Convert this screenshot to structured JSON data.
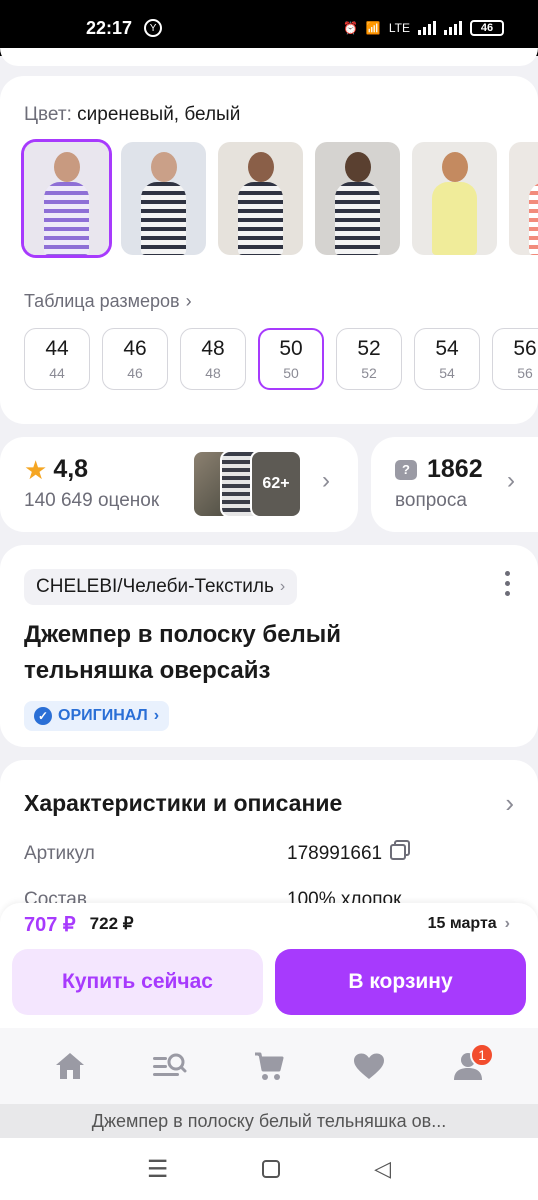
{
  "status_bar": {
    "time": "22:17",
    "network": "LTE",
    "battery": "46"
  },
  "color_section": {
    "label": "Цвет:",
    "value": "сиреневый, белый",
    "swatches": [
      "lilac-stripes",
      "navy-stripes",
      "black-stripes-grey",
      "black-stripes-black-hem",
      "yellow-knit",
      "coral-stripes"
    ]
  },
  "sizes": {
    "table_link": "Таблица размеров",
    "items": [
      {
        "size": "44",
        "ru": "44"
      },
      {
        "size": "46",
        "ru": "46"
      },
      {
        "size": "48",
        "ru": "48"
      },
      {
        "size": "50",
        "ru": "50"
      },
      {
        "size": "52",
        "ru": "52"
      },
      {
        "size": "54",
        "ru": "54"
      },
      {
        "size": "56",
        "ru": "56"
      }
    ],
    "selected": "50"
  },
  "rating": {
    "value": "4,8",
    "count": "140 649 оценок",
    "photos_more": "62+"
  },
  "questions": {
    "count": "1862",
    "label": "вопроса"
  },
  "product": {
    "brand": "CHELEBI/Челеби-Текстиль",
    "title": "Джемпер в полоску белый тельняшка оверсайз",
    "original_badge": "ОРИГИНАЛ"
  },
  "specs": {
    "heading": "Характеристики и описание",
    "rows": [
      {
        "key": "Артикул",
        "value": "178991661"
      },
      {
        "key": "Состав",
        "value": "100% хлопок"
      }
    ]
  },
  "buy_bar": {
    "price": "707 ₽",
    "old_price": "722 ₽",
    "delivery": "15 марта",
    "buy_now": "Купить сейчас",
    "add_to_cart": "В корзину"
  },
  "bottom_nav": {
    "profile_badge": "1"
  },
  "browser": {
    "page_title": "Джемпер в полоску белый тельняшка ов..."
  },
  "colors": {
    "accent": "#a73afd",
    "rating_star": "#f5a623",
    "original_blue": "#2a6fd6",
    "badge_red": "#f24d2e"
  }
}
